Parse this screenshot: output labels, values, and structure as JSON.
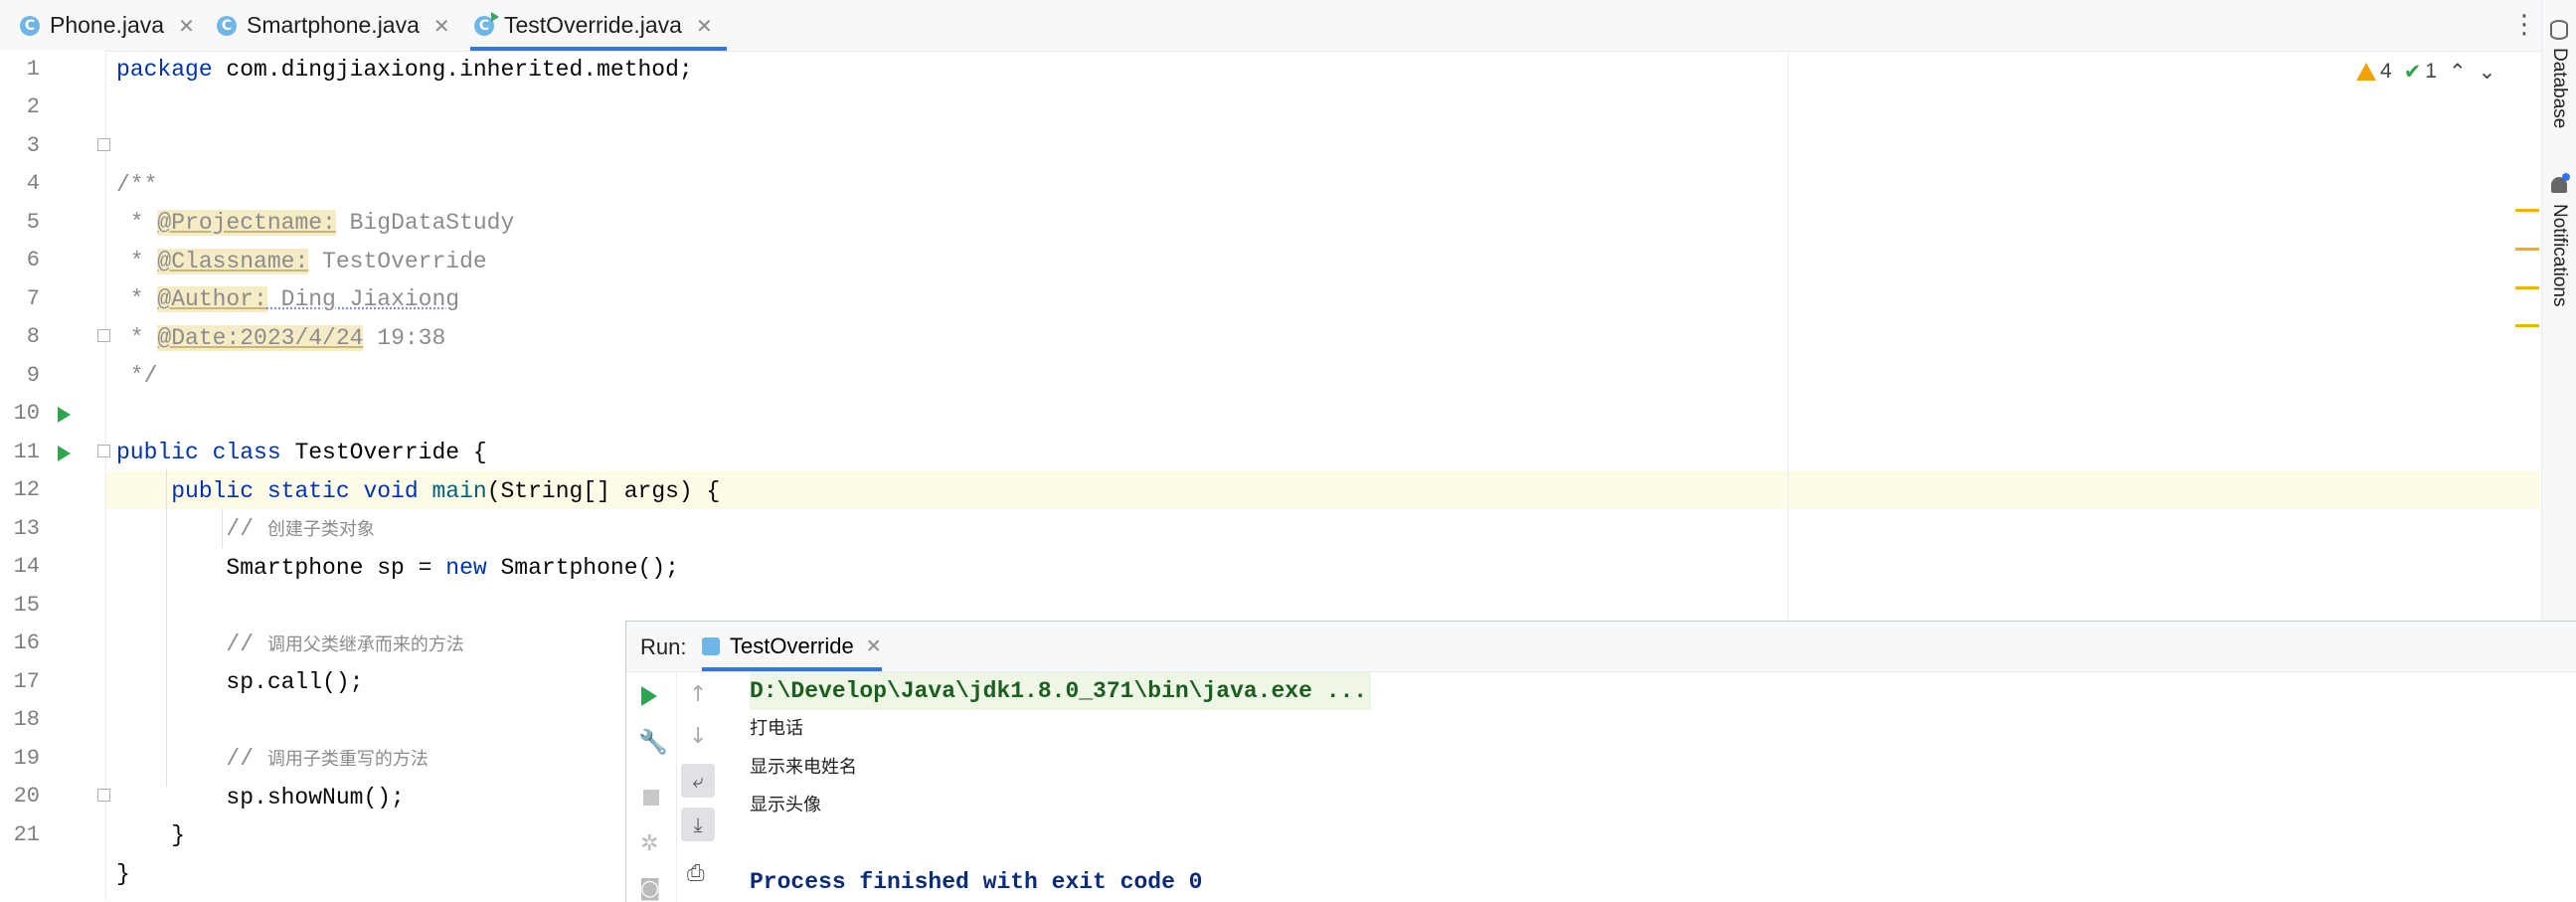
{
  "tabs": [
    {
      "label": "Phone.java",
      "active": false
    },
    {
      "label": "Smartphone.java",
      "active": false
    },
    {
      "label": "TestOverride.java",
      "active": true
    }
  ],
  "side_tools": {
    "database": "Database",
    "notifications": "Notifications"
  },
  "inspections": {
    "warnings": "4",
    "ok": "1"
  },
  "line_numbers": [
    "1",
    "2",
    "3",
    "4",
    "5",
    "6",
    "7",
    "8",
    "9",
    "10",
    "11",
    "12",
    "13",
    "14",
    "15",
    "16",
    "17",
    "18",
    "19",
    "20",
    "21"
  ],
  "code": {
    "l1_kw": "package",
    "l1_rest": " com.dingjiaxiong.inherited.method;",
    "l3": "/**",
    "l4_star": " * ",
    "l4_tag": "@Projectname:",
    "l4_val": " BigDataStudy",
    "l5_star": " * ",
    "l5_tag": "@Classname:",
    "l5_val": " TestOverride",
    "l6_star": " * ",
    "l6_tag": "@Author:",
    "l6_val": " Ding Jiaxiong",
    "l7_star": " * ",
    "l7_tag": "@Date:2023/4/24",
    "l7_val": " 19:38",
    "l8": " */",
    "l10_kw": "public class",
    "l10_rest": " TestOverride {",
    "l11_indent": "    ",
    "l11_kw": "public static void",
    "l11_fn": " main",
    "l11_rest": "(String[] args) {",
    "l12_indent": "        ",
    "l12_slash": "// ",
    "l12_cmt": "创建子类对象",
    "l13_a": "        Smartphone sp = ",
    "l13_kw": "new",
    "l13_b": " Smartphone();",
    "l15_indent": "        ",
    "l15_slash": "// ",
    "l15_cmt": "调用父类继承而来的方法",
    "l16": "        sp.call();",
    "l18_indent": "        ",
    "l18_slash": "// ",
    "l18_cmt": "调用子类重写的方法",
    "l19": "        sp.showNum();",
    "l20": "    }",
    "l21": "}"
  },
  "run": {
    "label": "Run:",
    "tab": "TestOverride",
    "console": [
      "D:\\Develop\\Java\\jdk1.8.0_371\\bin\\java.exe ...",
      "打电话",
      "显示来电姓名",
      "显示头像",
      "",
      "Process finished with exit code 0"
    ]
  },
  "icons": [
    "class-file-icon",
    "close-icon",
    "more-icon",
    "run-gutter-icon",
    "fold-icon",
    "bulb-icon",
    "warning-icon",
    "check-icon",
    "up-arrow-icon",
    "down-arrow-icon",
    "rerun-icon",
    "wrench-icon",
    "stop-icon",
    "bug-icon",
    "camera-icon",
    "soft-wrap-icon",
    "scroll-end-icon",
    "print-icon"
  ]
}
